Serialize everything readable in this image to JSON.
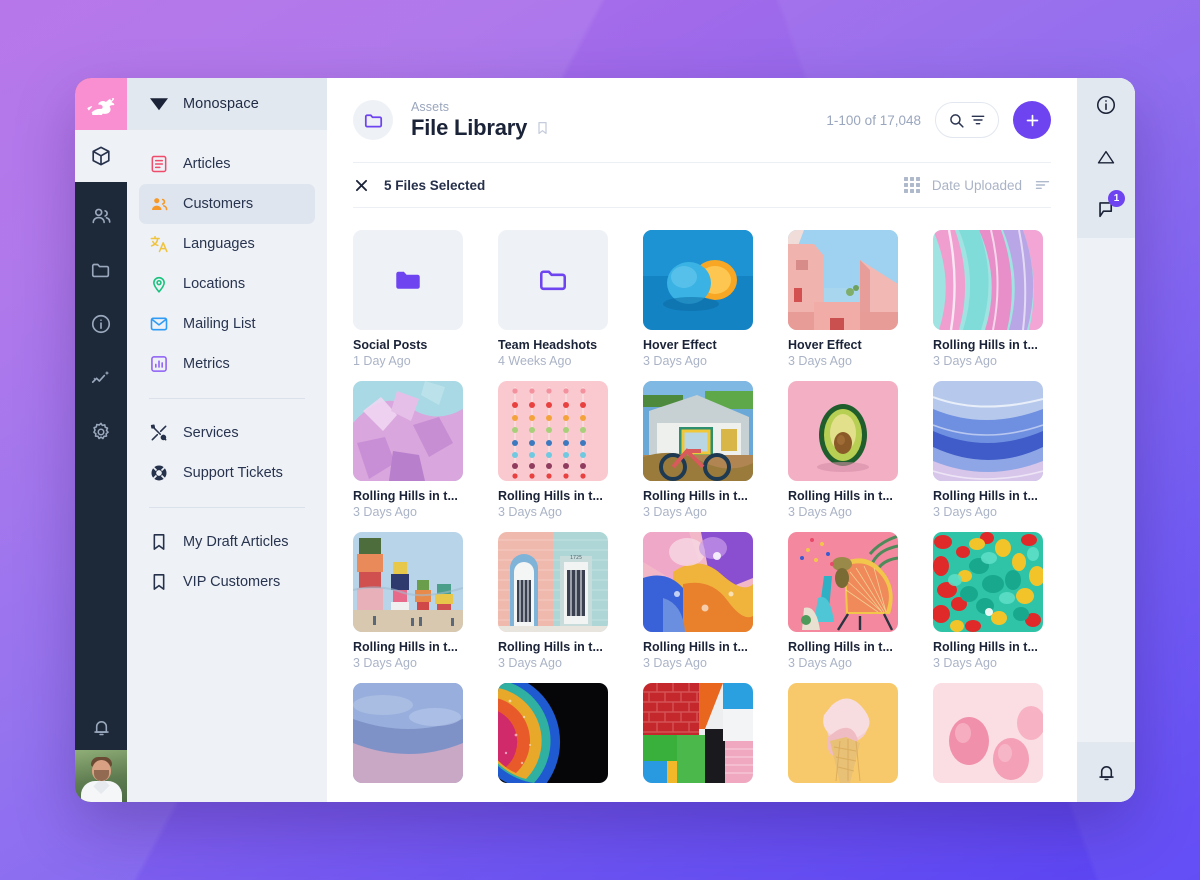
{
  "theme": {
    "accent": "#6d44f0",
    "logo_bg": "#f98fd0",
    "rail_bg": "#1d2939",
    "nav_bg": "#eef1f6",
    "nav_selected_bg": "#dfe5ee",
    "text_dark": "#1b2338",
    "text_muted": "#aab3c6"
  },
  "rail": {
    "logo_icon": "rabbit-logo-icon",
    "items": [
      {
        "icon": "cube-icon",
        "name": "rail-item-cube",
        "active": true
      },
      {
        "icon": "people-icon",
        "name": "rail-item-people",
        "active": false
      },
      {
        "icon": "folder-icon",
        "name": "rail-item-folder",
        "active": false
      },
      {
        "icon": "info-circle-icon",
        "name": "rail-item-info",
        "active": false
      },
      {
        "icon": "analytics-icon",
        "name": "rail-item-analytics",
        "active": false
      },
      {
        "icon": "gear-icon",
        "name": "rail-item-settings",
        "active": false
      }
    ],
    "bell_icon": "bell-icon",
    "avatar": "user-avatar"
  },
  "nav": {
    "workspace": "Monospace",
    "workspace_icon": "diamond-icon",
    "groups": [
      {
        "items": [
          {
            "label": "Articles",
            "icon": "articles-icon",
            "color": "#f04b6a",
            "selected": false
          },
          {
            "label": "Customers",
            "icon": "customers-icon",
            "color": "#f59a2a",
            "selected": true
          },
          {
            "label": "Languages",
            "icon": "languages-icon",
            "color": "#f0c33c",
            "selected": false
          },
          {
            "label": "Locations",
            "icon": "location-pin-icon",
            "color": "#19c27e",
            "selected": false
          },
          {
            "label": "Mailing List",
            "icon": "mail-icon",
            "color": "#2f9bf5",
            "selected": false
          },
          {
            "label": "Metrics",
            "icon": "metrics-icon",
            "color": "#8b5cf6",
            "selected": false
          }
        ]
      },
      {
        "items": [
          {
            "label": "Services",
            "icon": "tools-icon",
            "color": "#26314b",
            "selected": false
          },
          {
            "label": "Support Tickets",
            "icon": "lifebuoy-icon",
            "color": "#26314b",
            "selected": false
          }
        ]
      },
      {
        "items": [
          {
            "label": "My Draft Articles",
            "icon": "bookmark-icon",
            "color": "#26314b",
            "selected": false
          },
          {
            "label": "VIP Customers",
            "icon": "bookmark-icon",
            "color": "#26314b",
            "selected": false
          }
        ]
      }
    ]
  },
  "header": {
    "folder_icon": "folder-outline-icon",
    "eyebrow": "Assets",
    "title": "File Library",
    "bookmark_icon": "bookmark-outline-icon",
    "count": "1-100 of 17,048",
    "search_icon": "search-icon",
    "filter_icon": "filter-icon",
    "add_icon": "plus-icon",
    "add_label": "+"
  },
  "toolbar": {
    "close_icon": "close-icon",
    "selection_text": "5 Files Selected",
    "grid_icon": "grid-view-icon",
    "sort_label": "Date Uploaded",
    "sort_icon": "sort-icon"
  },
  "right_rail": {
    "items": [
      {
        "icon": "info-circle-icon",
        "name": "right-rail-info",
        "badge": null
      },
      {
        "icon": "warning-triangle-icon",
        "name": "right-rail-warning",
        "badge": null
      },
      {
        "icon": "comment-flag-icon",
        "name": "right-rail-comments",
        "badge": "1"
      }
    ],
    "bell_icon": "bell-icon"
  },
  "grid": {
    "items": [
      {
        "title": "Social Posts",
        "subtitle": "1 Day Ago",
        "kind": "folder-filled",
        "selected": true
      },
      {
        "title": "Team Headshots",
        "subtitle": "4 Weeks Ago",
        "kind": "folder-outline",
        "selected": false
      },
      {
        "title": "Hover Effect",
        "subtitle": "3 Days Ago",
        "kind": "image",
        "thumb": "blue-orange",
        "selected": false
      },
      {
        "title": "Hover Effect",
        "subtitle": "3 Days Ago",
        "kind": "image",
        "thumb": "pink-buildings",
        "selected": false
      },
      {
        "title": "Rolling Hills in t...",
        "subtitle": "3 Days Ago",
        "kind": "image",
        "thumb": "pink-marble",
        "selected": false
      },
      {
        "title": "Rolling Hills in t...",
        "subtitle": "3 Days Ago",
        "kind": "image",
        "thumb": "purple-crystal",
        "selected": false
      },
      {
        "title": "Rolling Hills in t...",
        "subtitle": "3 Days Ago",
        "kind": "image",
        "thumb": "pink-dots",
        "selected": false
      },
      {
        "title": "Rolling Hills in t...",
        "subtitle": "3 Days Ago",
        "kind": "image",
        "thumb": "blue-house",
        "selected": false
      },
      {
        "title": "Rolling Hills in t...",
        "subtitle": "3 Days Ago",
        "kind": "image",
        "thumb": "pink-avocado",
        "selected": false
      },
      {
        "title": "Rolling Hills in t...",
        "subtitle": "3 Days Ago",
        "kind": "image",
        "thumb": "blue-marble",
        "selected": false
      },
      {
        "title": "Rolling Hills in t...",
        "subtitle": "3 Days Ago",
        "kind": "image",
        "thumb": "stone-totems",
        "selected": false
      },
      {
        "title": "Rolling Hills in t...",
        "subtitle": "3 Days Ago",
        "kind": "image",
        "thumb": "two-doors",
        "selected": false
      },
      {
        "title": "Rolling Hills in t...",
        "subtitle": "3 Days Ago",
        "kind": "image",
        "thumb": "oil-bubbles",
        "selected": false
      },
      {
        "title": "Rolling Hills in t...",
        "subtitle": "3 Days Ago",
        "kind": "image",
        "thumb": "pink-chair",
        "selected": false
      },
      {
        "title": "Rolling Hills in t...",
        "subtitle": "3 Days Ago",
        "kind": "image",
        "thumb": "green-red-candy",
        "selected": false
      },
      {
        "title": "",
        "subtitle": "",
        "kind": "image",
        "thumb": "cloudy-sky",
        "selected": false
      },
      {
        "title": "",
        "subtitle": "",
        "kind": "image",
        "thumb": "iridescent-black",
        "selected": false
      },
      {
        "title": "",
        "subtitle": "",
        "kind": "image",
        "thumb": "color-blocks",
        "selected": false
      },
      {
        "title": "",
        "subtitle": "",
        "kind": "image",
        "thumb": "ice-cream",
        "selected": false
      },
      {
        "title": "",
        "subtitle": "",
        "kind": "image",
        "thumb": "pink-balloons",
        "selected": false
      }
    ]
  }
}
